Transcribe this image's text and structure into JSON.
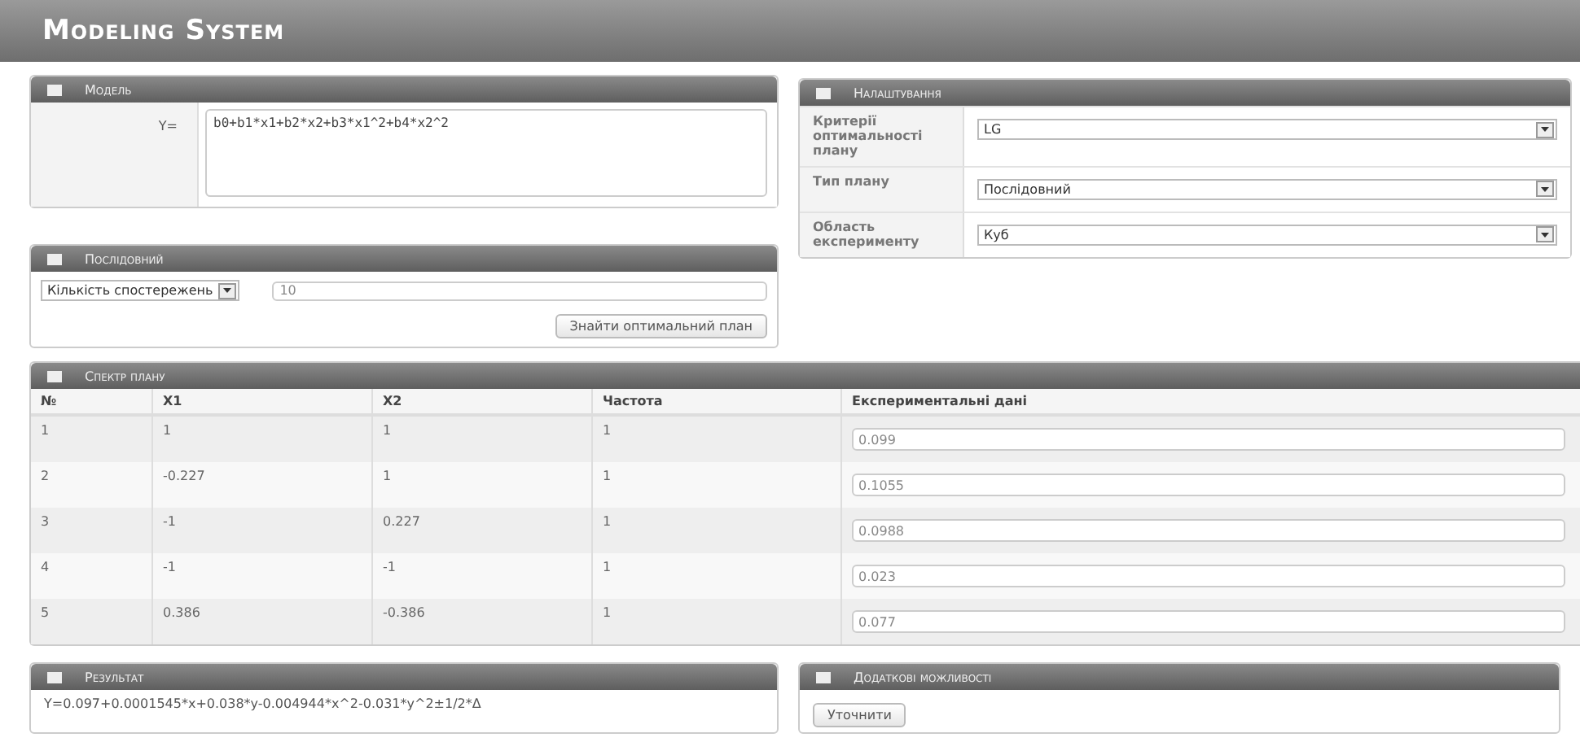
{
  "app_title": "Modeling System",
  "model": {
    "title": "Модель",
    "label": "Y=",
    "value": "b0+b1*x1+b2*x2+b3*x1^2+b4*x2^2"
  },
  "settings": {
    "title": "Налаштування",
    "fields": [
      {
        "label": "Критерії оптимальності плану",
        "value": "LG"
      },
      {
        "label": "Тип плану",
        "value": "Послідовний"
      },
      {
        "label": "Область експерименту",
        "value": "Куб"
      }
    ]
  },
  "sequential": {
    "title": "Послідовний",
    "select": "Кількість спостережень",
    "value": "10",
    "button": "Знайти оптимальний план"
  },
  "spectrum": {
    "title": "Спектр плану",
    "columns": [
      "№",
      "X1",
      "X2",
      "Частота",
      "Експериментальні дані"
    ],
    "rows": [
      {
        "cells": [
          "1",
          "1",
          "1",
          "1"
        ],
        "data": "0.099"
      },
      {
        "cells": [
          "2",
          "-0.227",
          "1",
          "1"
        ],
        "data": "0.1055"
      },
      {
        "cells": [
          "3",
          "-1",
          "0.227",
          "1"
        ],
        "data": "0.0988"
      },
      {
        "cells": [
          "4",
          "-1",
          "-1",
          "1"
        ],
        "data": "0.023"
      },
      {
        "cells": [
          "5",
          "0.386",
          "-0.386",
          "1"
        ],
        "data": "0.077"
      }
    ]
  },
  "result": {
    "title": "Результат",
    "text": "Y=0.097+0.0001545*x+0.038*y-0.004944*x^2-0.031*y^2±1/2*Δ"
  },
  "extra": {
    "title": "Додаткові можливості",
    "button": "Уточнити"
  }
}
